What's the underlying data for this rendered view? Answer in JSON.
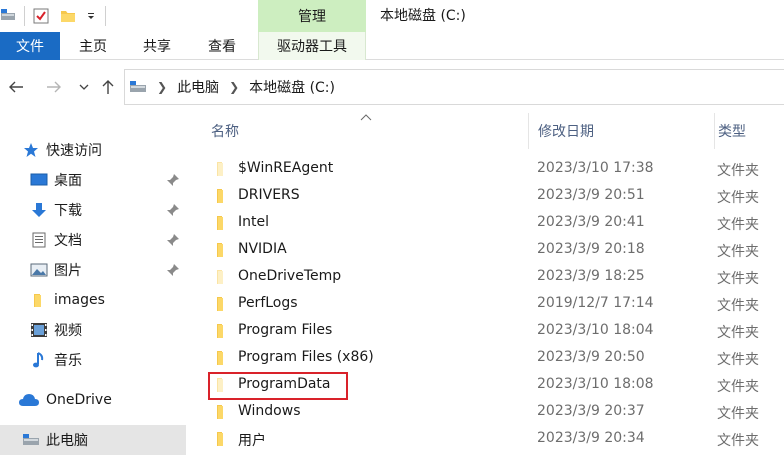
{
  "window": {
    "title": "本地磁盘 (C:)",
    "context_tab": "管理"
  },
  "ribbon": {
    "tabs": [
      "文件",
      "主页",
      "共享",
      "查看",
      "驱动器工具"
    ],
    "active_color": "#1a6bc4",
    "context_color": "#cdeec0"
  },
  "address": {
    "crumbs": [
      "此电脑",
      "本地磁盘 (C:)"
    ]
  },
  "sidebar": {
    "items": [
      {
        "label": "快速访问",
        "icon": "star-icon"
      },
      {
        "label": "桌面",
        "icon": "desktop-icon",
        "pinned": true
      },
      {
        "label": "下载",
        "icon": "download-icon",
        "pinned": true
      },
      {
        "label": "文档",
        "icon": "document-icon",
        "pinned": true
      },
      {
        "label": "图片",
        "icon": "picture-icon",
        "pinned": true
      },
      {
        "label": "images",
        "icon": "folder-icon"
      },
      {
        "label": "视频",
        "icon": "video-icon"
      },
      {
        "label": "音乐",
        "icon": "music-icon"
      },
      {
        "label": "OneDrive",
        "icon": "cloud-icon"
      },
      {
        "label": "此电脑",
        "icon": "computer-icon",
        "selected": true
      }
    ]
  },
  "columns": {
    "name": "名称",
    "date": "修改日期",
    "type": "类型"
  },
  "files": [
    {
      "name": "$WinREAgent",
      "date": "2023/3/10 17:38",
      "type": "文件夹",
      "faded": true
    },
    {
      "name": "DRIVERS",
      "date": "2023/3/9 20:51",
      "type": "文件夹"
    },
    {
      "name": "Intel",
      "date": "2023/3/9 20:41",
      "type": "文件夹"
    },
    {
      "name": "NVIDIA",
      "date": "2023/3/9 20:18",
      "type": "文件夹"
    },
    {
      "name": "OneDriveTemp",
      "date": "2023/3/9 18:25",
      "type": "文件夹",
      "faded": true
    },
    {
      "name": "PerfLogs",
      "date": "2019/12/7 17:14",
      "type": "文件夹"
    },
    {
      "name": "Program Files",
      "date": "2023/3/10 18:04",
      "type": "文件夹"
    },
    {
      "name": "Program Files (x86)",
      "date": "2023/3/9 20:50",
      "type": "文件夹"
    },
    {
      "name": "ProgramData",
      "date": "2023/3/10 18:08",
      "type": "文件夹",
      "faded": true,
      "highlighted": true
    },
    {
      "name": "Windows",
      "date": "2023/3/9 20:37",
      "type": "文件夹"
    },
    {
      "name": "用户",
      "date": "2023/3/9 20:34",
      "type": "文件夹"
    }
  ]
}
